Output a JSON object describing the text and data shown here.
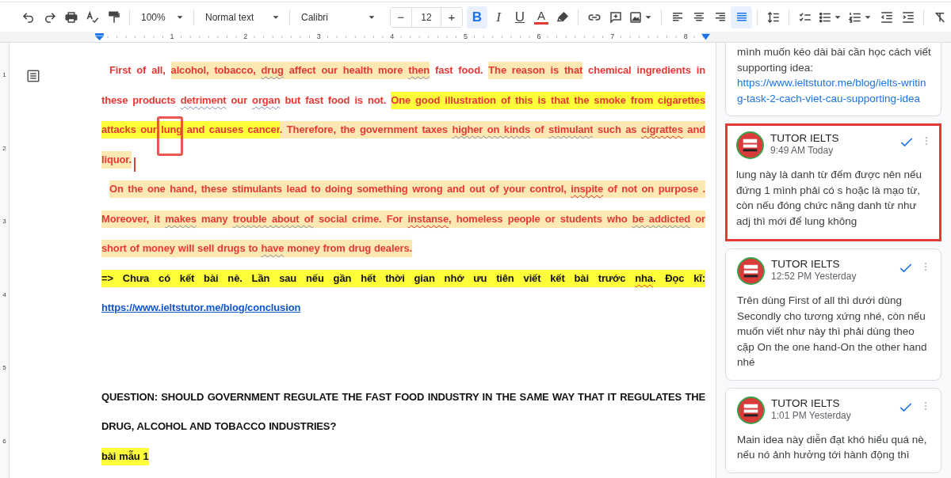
{
  "toolbar": {
    "zoom": "100%",
    "paragraph_style": "Normal text",
    "font": "Calibri",
    "font_size": {
      "minus": "−",
      "value": "12",
      "plus": "+"
    },
    "text_format": [
      {
        "kind": "bold",
        "label": "B",
        "selected": true
      },
      {
        "kind": "italic",
        "label": "I",
        "selected": false
      },
      {
        "kind": "underline",
        "label": "U",
        "selected": false
      },
      {
        "kind": "text-color",
        "label": "A",
        "color": "#e53935"
      }
    ],
    "alignment": [
      {
        "kind": "left",
        "selected": false
      },
      {
        "kind": "center",
        "selected": false
      },
      {
        "kind": "right",
        "selected": false
      },
      {
        "kind": "justify",
        "selected": true
      }
    ]
  },
  "ruler": {
    "marks": [
      "1",
      "2",
      "3",
      "4",
      "5",
      "6",
      "7",
      "8"
    ],
    "vertical_marks": [
      "1",
      "2",
      "3",
      "4",
      "5",
      "6"
    ]
  },
  "document": {
    "paragraphs": [
      {
        "kind": "feedback",
        "lines": [
          {
            "runs": [
              {
                "text": "First of all, "
              },
              {
                "text": "alcohol, tobacco, ",
                "color": "#fce8b2"
              },
              {
                "text": "drug",
                "color": "#fce8b2",
                "grammar_flag": true
              },
              {
                "text": " affect our health more ",
                "color": "#fce8b2"
              },
              {
                "text": "then",
                "color": "#fce8b2",
                "grammar_flag": true
              },
              {
                "text": " fast food. "
              },
              {
                "text": "The reason is that",
                "color": "#fce8b2"
              },
              {
                "text": " chemical ingredients in"
              }
            ]
          },
          {
            "runs": [
              {
                "text": "these products "
              },
              {
                "text": "detriment",
                "grammar_flag": true
              },
              {
                "text": " our "
              },
              {
                "text": "organ",
                "grammar_flag": true
              },
              {
                "text": " but fast food is not. "
              },
              {
                "text": "One good illustration of this is that the smoke from cigarettes",
                "color": "#ffff3a"
              }
            ]
          },
          {
            "runs": [
              {
                "text": "attacks our ",
                "color": "#ffff3a"
              },
              {
                "text": "lung",
                "color": "#ffff3a",
                "circled": true
              },
              {
                "text": " and causes cancer",
                "color": "#ffff3a"
              },
              {
                "text": ". Therefore, the government taxes ",
                "color": "#fce8b2"
              },
              {
                "text": "higher on kinds",
                "color": "#fce8b2",
                "grammar_flag": true
              },
              {
                "text": " of ",
                "color": "#fce8b2"
              },
              {
                "text": "stimulant",
                "color": "#fce8b2",
                "grammar_flag": true
              },
              {
                "text": " such as ",
                "color": "#fce8b2"
              },
              {
                "text": "cigrattes",
                "color": "#fce8b2",
                "misspelled": true
              },
              {
                "text": " and",
                "color": "#fce8b2"
              }
            ]
          },
          {
            "runs": [
              {
                "text": "liquor.",
                "color": "#fce8b2",
                "cursor": true
              }
            ]
          }
        ]
      },
      {
        "kind": "feedback",
        "lines": [
          {
            "runs": [
              {
                "text": "On the one hand, these stimulants lead to doing something wrong and out of your control, ",
                "color": "#fce8b2"
              },
              {
                "text": "inspite",
                "color": "#fce8b2",
                "misspelled": true
              },
              {
                "text": " of not on purpose .",
                "color": "#fce8b2"
              }
            ]
          },
          {
            "runs": [
              {
                "text": "Moreover, it ",
                "color": "#fce8b2"
              },
              {
                "text": "makes",
                "color": "#fce8b2",
                "grammar_flag": true
              },
              {
                "text": " many ",
                "color": "#fce8b2"
              },
              {
                "text": "trouble about of",
                "color": "#fce8b2",
                "grammar_flag": true
              },
              {
                "text": " social crime. For ",
                "color": "#fce8b2"
              },
              {
                "text": "instanse",
                "color": "#fce8b2",
                "misspelled": true
              },
              {
                "text": ", homeless people or students who ",
                "color": "#fce8b2"
              },
              {
                "text": "be addicted",
                "color": "#fce8b2",
                "grammar_flag": true
              },
              {
                "text": " or",
                "color": "#fce8b2"
              }
            ]
          },
          {
            "runs": [
              {
                "text": "short of money will sell drugs to ",
                "color": "#fce8b2"
              },
              {
                "text": "have",
                "color": "#fce8b2",
                "grammar_flag": true
              },
              {
                "text": " money from drug dealers.",
                "color": "#fce8b2"
              }
            ]
          }
        ]
      },
      {
        "kind": "note",
        "lines": [
          {
            "runs": [
              {
                "text": "=> Chưa có kết bài nè. Lần sau nếu gần hết thời gian nhớ ưu tiên viết kết bài trước ",
                "color": "#ffff3a"
              },
              {
                "text": "nha",
                "color": "#ffff3a",
                "misspelled": true
              },
              {
                "text": ". Đọc kĩ:",
                "color": "#ffff3a"
              }
            ]
          },
          {
            "runs": [
              {
                "text": "https://www.ieltstutor.me/blog/conclusion",
                "link": true
              }
            ]
          }
        ]
      },
      {
        "kind": "question",
        "lines": [
          {
            "runs": [
              {
                "text": "QUESTION: SHOULD GOVERNMENT REGULATE THE FAST FOOD INDUSTRY IN THE SAME WAY THAT IT REGULATES THE"
              }
            ]
          },
          {
            "runs": [
              {
                "text": "DRUG, ALCOHOL AND TOBACCO INDUSTRIES?"
              }
            ]
          }
        ]
      },
      {
        "kind": "note",
        "lines": [
          {
            "runs": [
              {
                "text": "bài mẫu 1",
                "color": "#ffff3a"
              }
            ]
          }
        ]
      }
    ]
  },
  "comments": [
    {
      "body": "mình muốn kéo dài bài cần học cách viết supporting idea:",
      "link": "https://www.ieltstutor.me/blog/ielts-writing-task-2-cach-viet-cau-supporting-idea",
      "highlighted": false
    },
    {
      "author": "TUTOR IELTS",
      "time": "9:49 AM Today",
      "body": "lung này là danh từ đếm được nên nếu đứng 1 mình phải có s hoặc là mạo từ, còn nếu đóng chức năng danh từ như adj thì mới để lung không",
      "highlighted": true
    },
    {
      "author": "TUTOR IELTS",
      "time": "12:52 PM Yesterday",
      "body": "Trên dùng First of all thì dưới dùng Secondly cho tương xứng nhé, còn nếu muốn viết như này thì phải dùng theo cặp On the one hand-On the other hand nhé",
      "highlighted": false
    },
    {
      "author": "TUTOR IELTS",
      "time": "1:01 PM Yesterday",
      "body": "Main idea này diễn đạt khó hiểu quá nè, nếu nó ảnh hưởng tới hành động thì",
      "highlighted": false
    }
  ]
}
